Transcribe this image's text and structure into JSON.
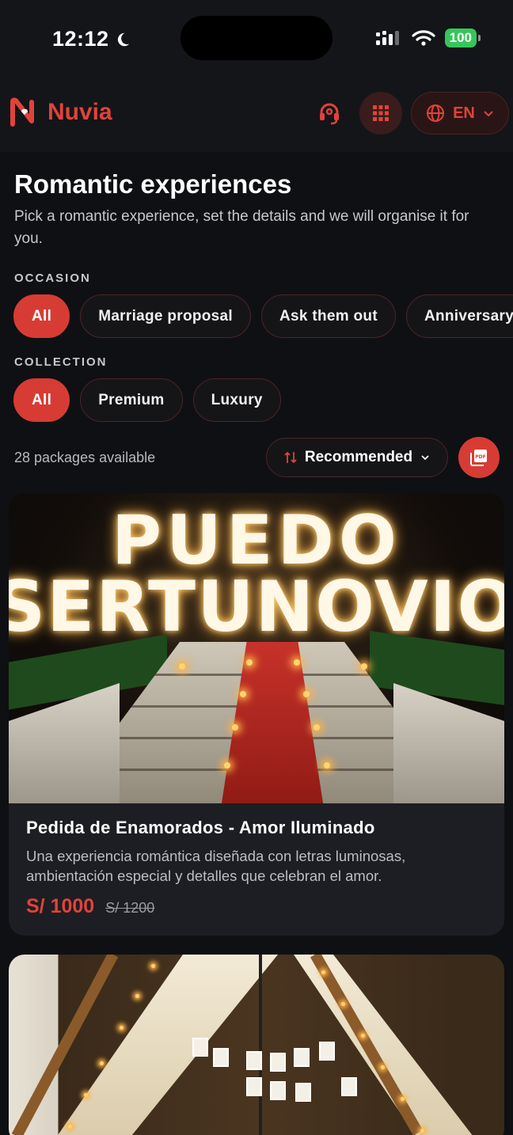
{
  "status_bar": {
    "time": "12:12",
    "battery": "100"
  },
  "header": {
    "brand": "Nuvia",
    "language": "EN"
  },
  "page": {
    "title": "Romantic experiences",
    "subtitle": "Pick a romantic experience, set the details and we will organise it for you."
  },
  "filters": {
    "occasion_label": "OCCASION",
    "occasions": [
      "All",
      "Marriage proposal",
      "Ask them out",
      "Anniversary"
    ],
    "collection_label": "COLLECTION",
    "collections": [
      "All",
      "Premium",
      "Luxury"
    ]
  },
  "results": {
    "count_text": "28 packages available",
    "sort_label": "Recommended"
  },
  "cards": [
    {
      "title": "Pedida de Enamorados - Amor Iluminado",
      "description": "Una experiencia romántica diseñada con letras luminosas, ambientación especial y detalles que celebran el amor.",
      "price": "S/ 1000",
      "old_price": "S/ 1200",
      "photo_text_1": "PUEDO",
      "photo_text_2": "SERTUNOVIO"
    }
  ],
  "colors": {
    "accent": "#d63c34",
    "background": "#0f1013",
    "card": "#1d1e23"
  },
  "icons": [
    "moon-icon",
    "signal-icon",
    "wifi-icon",
    "support-icon",
    "grid-icon",
    "globe-icon",
    "chevron-down-icon",
    "sort-icon",
    "pdf-icon"
  ]
}
